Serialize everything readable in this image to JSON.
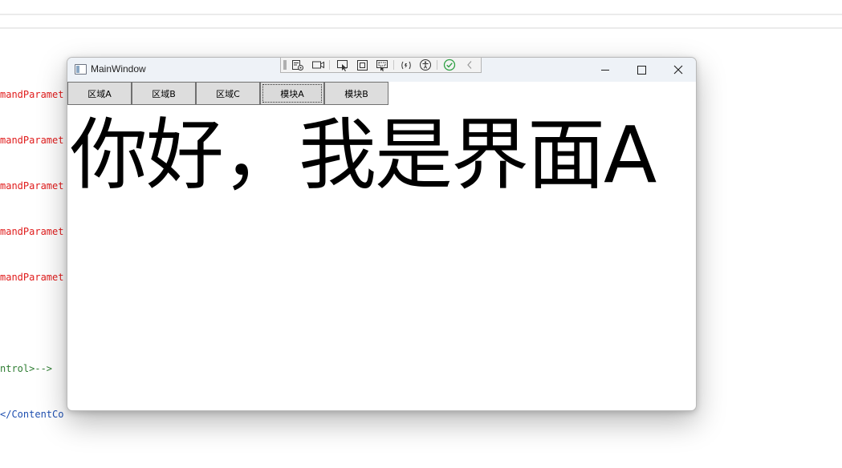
{
  "editor": {
    "code_lines": [
      {
        "text": "mandParamet",
        "color": "red"
      },
      {
        "text": "mandParamet",
        "color": "red"
      },
      {
        "text": "mandParamet",
        "color": "red"
      },
      {
        "text": "mandParamet",
        "color": "red"
      },
      {
        "text": "mandParamet",
        "color": "red"
      },
      {
        "text": "",
        "color": "none"
      },
      {
        "text": "ntrol>-->",
        "color": "green"
      },
      {
        "text": "</ContentCo",
        "color": "blue"
      }
    ]
  },
  "window": {
    "title": "MainWindow",
    "controls": {
      "minimize": "minimize-icon",
      "maximize": "maximize-icon",
      "close": "close-icon"
    }
  },
  "debug_toolbar": {
    "icons": [
      "live-visual-tree-icon",
      "record-icon",
      "select-element-icon",
      "display-layout-adorners-icon",
      "track-focus-icon",
      "hot-reload-icon",
      "accessibility-icon",
      "binding-check-icon",
      "collapse-icon"
    ],
    "colors": {
      "check": "#2ea043"
    }
  },
  "tabs": [
    {
      "label": "区域A",
      "focused": false
    },
    {
      "label": "区域B",
      "focused": false
    },
    {
      "label": "区域C",
      "focused": false
    },
    {
      "label": "模块A",
      "focused": true
    },
    {
      "label": "模块B",
      "focused": false
    }
  ],
  "content": {
    "greeting": "你好，我是界面A"
  }
}
